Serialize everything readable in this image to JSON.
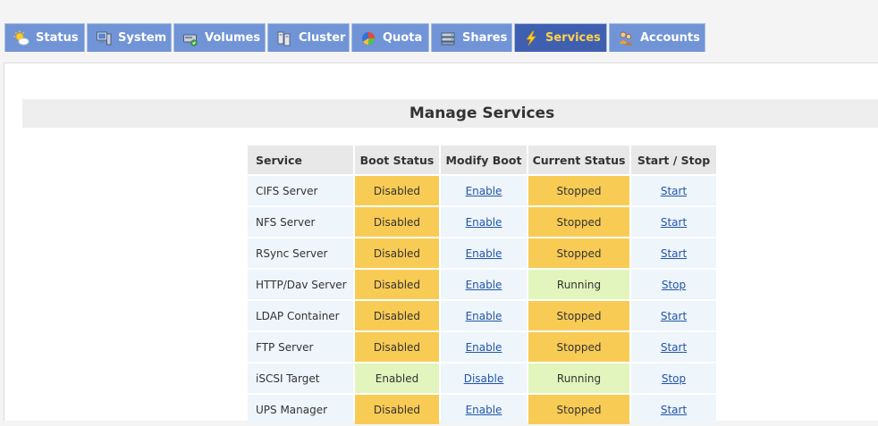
{
  "tabs": [
    {
      "label": "Status",
      "icon": "weather-sun-icon",
      "active": false
    },
    {
      "label": "System",
      "icon": "computer-icon",
      "active": false
    },
    {
      "label": "Volumes",
      "icon": "disk-icon",
      "active": false
    },
    {
      "label": "Cluster",
      "icon": "cluster-icon",
      "active": false
    },
    {
      "label": "Quota",
      "icon": "pie-chart-icon",
      "active": false
    },
    {
      "label": "Shares",
      "icon": "server-icon",
      "active": false
    },
    {
      "label": "Services",
      "icon": "lightning-icon",
      "active": true
    },
    {
      "label": "Accounts",
      "icon": "users-icon",
      "active": false
    }
  ],
  "page": {
    "title": "Manage Services"
  },
  "table": {
    "headers": [
      "Service",
      "Boot Status",
      "Modify Boot",
      "Current Status",
      "Start / Stop"
    ],
    "rows": [
      {
        "service": "CIFS Server",
        "boot": "Disabled",
        "modify": "Enable",
        "current": "Stopped",
        "action": "Start"
      },
      {
        "service": "NFS Server",
        "boot": "Disabled",
        "modify": "Enable",
        "current": "Stopped",
        "action": "Start"
      },
      {
        "service": "RSync Server",
        "boot": "Disabled",
        "modify": "Enable",
        "current": "Stopped",
        "action": "Start"
      },
      {
        "service": "HTTP/Dav Server",
        "boot": "Disabled",
        "modify": "Enable",
        "current": "Running",
        "action": "Stop"
      },
      {
        "service": "LDAP Container",
        "boot": "Disabled",
        "modify": "Enable",
        "current": "Stopped",
        "action": "Start"
      },
      {
        "service": "FTP Server",
        "boot": "Disabled",
        "modify": "Enable",
        "current": "Stopped",
        "action": "Start"
      },
      {
        "service": "iSCSI Target",
        "boot": "Enabled",
        "modify": "Disable",
        "current": "Running",
        "action": "Stop"
      },
      {
        "service": "UPS Manager",
        "boot": "Disabled",
        "modify": "Enable",
        "current": "Stopped",
        "action": "Start"
      }
    ]
  },
  "colors": {
    "tab_bg": "#7094d6",
    "tab_active_bg": "#3f5fb0",
    "tab_active_text": "#ffd34d",
    "disabled_stopped": "#f8cb55",
    "enabled_running": "#e2f5bc",
    "row_bg": "#eef5fb",
    "link": "#2255aa"
  }
}
